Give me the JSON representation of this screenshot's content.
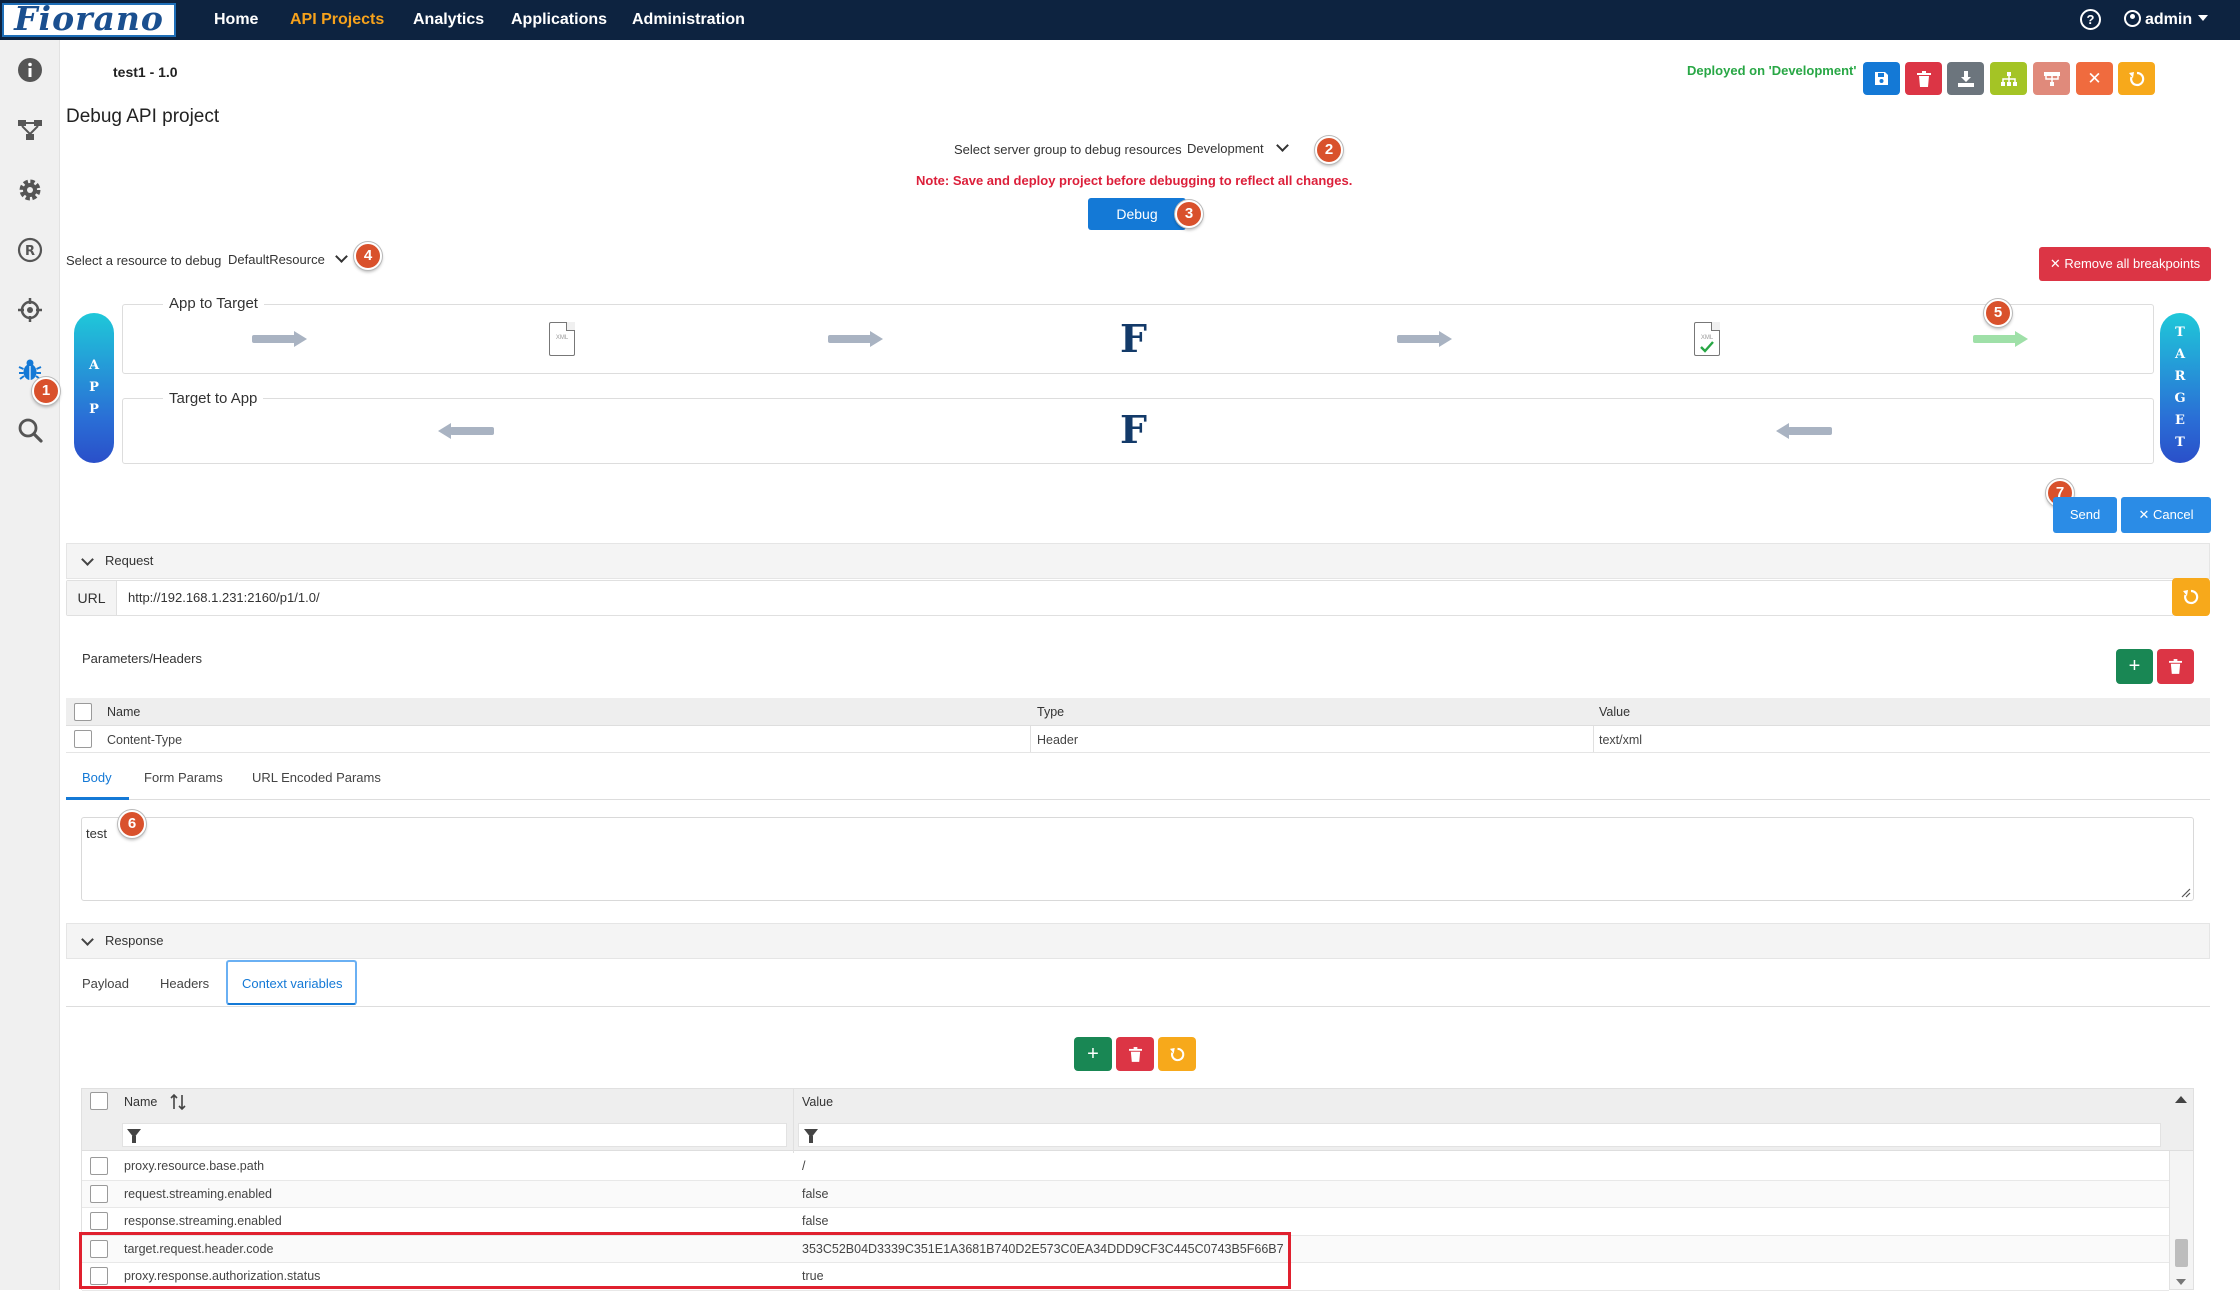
{
  "brand": "Fiorano",
  "nav": {
    "items": [
      "Home",
      "API Projects",
      "Analytics",
      "Applications",
      "Administration"
    ],
    "active": "API Projects",
    "user": "admin"
  },
  "project": {
    "title": "test1 - 1.0",
    "deploy_status": "Deployed on 'Development'",
    "page_heading": "Debug API project"
  },
  "toolbar": {
    "colors": {
      "save": "#1479d6",
      "delete": "#dc3545",
      "download": "#6c757d",
      "deploy": "#a4c425",
      "undeploy": "#e08a7b",
      "close": "#f06b3e",
      "refresh": "#f7a91b"
    }
  },
  "debug": {
    "server_group_label": "Select server group to debug resources",
    "server_group_value": "Development",
    "note": "Note: Save and deploy project before debugging to reflect all changes.",
    "debug_button": "Debug",
    "resource_label": "Select a resource to debug",
    "resource_value": "DefaultResource",
    "remove_breakpoints": "Remove all breakpoints"
  },
  "flow": {
    "left_pill": "APP",
    "right_pill": "TARGET",
    "app_to_target": "App to Target",
    "target_to_app": "Target to App",
    "fiorano_glyph": "F",
    "doc_text": "XML"
  },
  "badges": [
    "1",
    "2",
    "3",
    "4",
    "5",
    "6",
    "7"
  ],
  "actions": {
    "send": "Send",
    "cancel": "Cancel"
  },
  "request": {
    "header": "Request",
    "url_label": "URL",
    "url": "http://192.168.1.231:2160/p1/1.0/",
    "params_title": "Parameters/Headers",
    "columns": [
      "Name",
      "Type",
      "Value"
    ],
    "rows": [
      {
        "name": "Content-Type",
        "type": "Header",
        "value": "text/xml"
      }
    ],
    "tabs": [
      "Body",
      "Form Params",
      "URL Encoded Params"
    ],
    "active_tab": "Body",
    "body": "test"
  },
  "response": {
    "header": "Response",
    "tabs": [
      "Payload",
      "Headers",
      "Context variables"
    ],
    "active_tab": "Context variables",
    "columns": [
      "Name",
      "Value"
    ],
    "rows": [
      {
        "name": "proxy.resource.base.path",
        "value": "/"
      },
      {
        "name": "request.streaming.enabled",
        "value": "false"
      },
      {
        "name": "response.streaming.enabled",
        "value": "false"
      },
      {
        "name": "target.request.header.code",
        "value": "353C52B04D3339C351E1A3681B740D2E573C0EA34DDD9CF3C445C0743B5F66B7"
      },
      {
        "name": "proxy.response.authorization.status",
        "value": "true"
      }
    ]
  }
}
